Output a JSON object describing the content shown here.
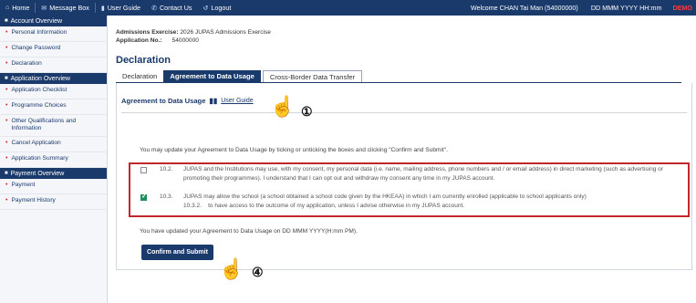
{
  "topbar": {
    "home": "Home",
    "message_box": "Message Box",
    "user_guide": "User Guide",
    "contact_us": "Contact Us",
    "logout": "Logout",
    "welcome": "Welcome CHAN Tai Man (54000000)",
    "datetime": "DD MMM YYYY HH:mm",
    "demo": "DEMO"
  },
  "sidebar": {
    "sections": [
      {
        "title": "Account Overview",
        "items": [
          "Personal Information",
          "Change Password",
          "Declaration"
        ]
      },
      {
        "title": "Application Overview",
        "items": [
          "Application Checklist",
          "Programme Choices",
          "Other Qualifications and Information",
          "Cancel Application",
          "Application Summary"
        ]
      },
      {
        "title": "Payment Overview",
        "items": [
          "Payment",
          "Payment History"
        ]
      }
    ]
  },
  "main": {
    "exercise_label": "Admissions Exercise:",
    "exercise_value": "2026 JUPAS Admissions Exercise",
    "appno_label": "Application No.:",
    "appno_value": "54000000",
    "title": "Declaration",
    "tabs": [
      "Declaration",
      "Agreement to Data Usage",
      "Cross-Border Data Transfer"
    ],
    "section_title": "Agreement to Data Usage",
    "user_guide_link": "User Guide",
    "instruction": "You may update your Agreement to Data Usage by ticking or unticking the boxes and clicking \"Confirm and Submit\".",
    "items": [
      {
        "num": "10.2.",
        "checked": false,
        "text": "JUPAS and the Institutions may use, with my consent, my personal data (i.e. name, mailing address, phone numbers and / or email address) in direct marketing (such as advertising or promoting their programmes). I understand that I can opt out and withdraw my consent any time in my JUPAS account."
      },
      {
        "num": "10.3.",
        "checked": true,
        "text": "JUPAS may allow the school (a school obtained a school code given by the HKEAA) in which I am currently enrolled (applicable to school applicants only)",
        "subnum": "10.3.2.",
        "subtext": "to have access to the outcome of my application, unless I advise otherwise in my JUPAS account."
      }
    ],
    "updated_text": "You have updated your Agreement to Data Usage on DD MMM YYYY(H:mm PM).",
    "confirm_button": "Confirm and Submit"
  },
  "annotations": {
    "callout_1": "①",
    "callout_4": "④"
  },
  "colors": {
    "navy": "#1a3a6b",
    "highlight": "#c0282d",
    "check": "#1f8f5f",
    "demo": "#ff3b3b"
  }
}
